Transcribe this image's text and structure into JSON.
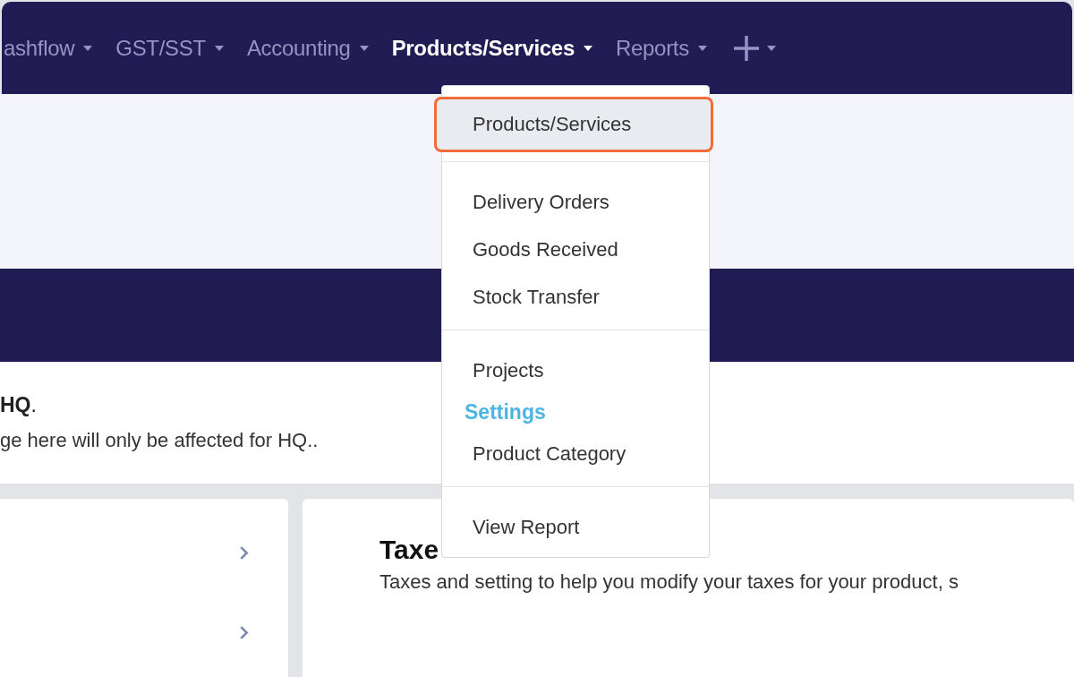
{
  "nav": {
    "items": [
      {
        "label": "ashflow",
        "selected": false,
        "kind": "menu"
      },
      {
        "label": "GST/SST",
        "selected": false,
        "kind": "menu"
      },
      {
        "label": "Accounting",
        "selected": false,
        "kind": "menu"
      },
      {
        "label": "Products/Services",
        "selected": true,
        "kind": "menu"
      },
      {
        "label": "Reports",
        "selected": false,
        "kind": "menu"
      },
      {
        "selected": false,
        "kind": "add"
      }
    ]
  },
  "dropdown": {
    "items": [
      {
        "kind": "item",
        "label": "Products/Services",
        "selected": true
      },
      {
        "kind": "divider"
      },
      {
        "kind": "item",
        "label": "Delivery Orders",
        "selected": false
      },
      {
        "kind": "item",
        "label": "Goods Received",
        "selected": false
      },
      {
        "kind": "item",
        "label": "Stock Transfer",
        "selected": false
      },
      {
        "kind": "divider"
      },
      {
        "kind": "item",
        "label": "Projects",
        "selected": false
      },
      {
        "kind": "header",
        "label": "Settings"
      },
      {
        "kind": "item",
        "label": "Product Category",
        "selected": false
      },
      {
        "kind": "divider"
      },
      {
        "kind": "item",
        "label": "View Report",
        "selected": false
      }
    ]
  },
  "notice": {
    "title": "**HQ**.",
    "text": "ge here will only be affected for HQ.."
  },
  "cards": [
    {
      "kind": "list"
    },
    {
      "kind": "setting",
      "title": "Taxe",
      "text": "Taxes and setting to help you modify your taxes for your product, s"
    }
  ]
}
